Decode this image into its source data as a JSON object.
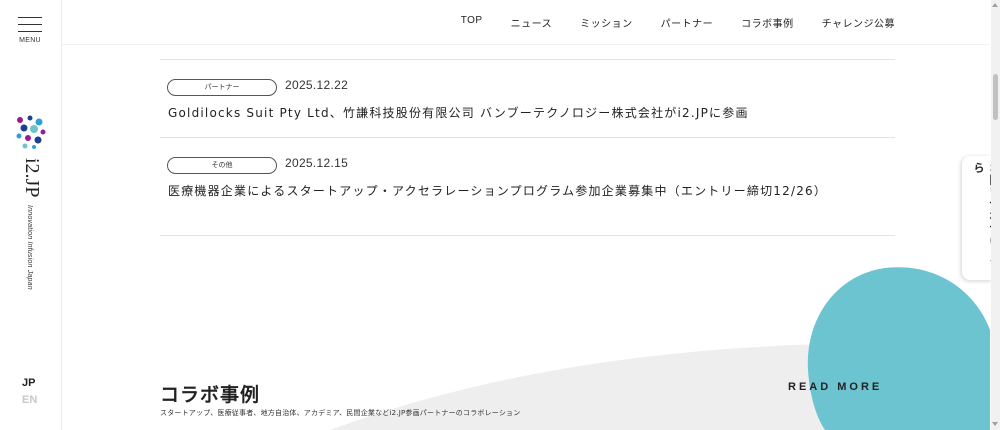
{
  "sidebar": {
    "menu_label": "MENU",
    "logo_text": "i2.JP",
    "logo_tagline": "Innovation Infusion Japan",
    "lang_jp": "JP",
    "lang_en": "EN"
  },
  "nav": {
    "items": [
      "TOP",
      "ニュース",
      "ミッション",
      "パートナー",
      "コラボ事例",
      "チャレンジ公募"
    ]
  },
  "news": [
    {
      "tag": "パートナー",
      "date": "2025.12.22",
      "title": "Goldilocks Suit Pty Ltd、竹謙科技股份有限公司 バンブーテクノロジー株式会社がi2.JPに参画"
    },
    {
      "tag": "その他",
      "date": "2025.12.15",
      "title": "医療機器企業によるスタートアップ・アクセラレーションプログラム参加企業募集中（エントリー締切12/26）"
    }
  ],
  "collab": {
    "title": "コラボ事例",
    "subtitle": "スタートアップ、医療従事者、地方自治体、アカデミア、民間企業などi2.JP参画パートナーのコラボレーション",
    "read_more": "READ MORE"
  },
  "contact_tab": "お問い合わせはこちら",
  "colors": {
    "teal_blob": "#6cc4d1",
    "gray_arc": "#eeeeee"
  }
}
